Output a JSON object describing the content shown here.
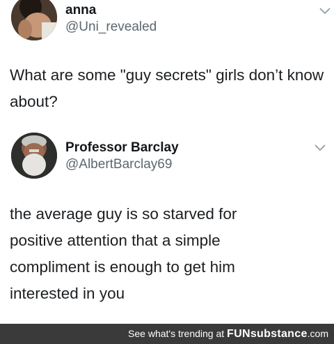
{
  "tweets": [
    {
      "name": "anna",
      "handle": "@Uni_revealed",
      "text": "What are some \"guy secrets\" girls don’t know about?"
    },
    {
      "name": "Professor Barclay",
      "handle": "@AlbertBarclay69",
      "text": "the average guy is so starved for positive attention that a simple compliment is enough to get him interested in you"
    }
  ],
  "footer": {
    "prefix": "See what's trending at ",
    "brand": "FUNsubstance",
    "suffix": ".com",
    "background": "#3a3a3a"
  },
  "icons": {
    "menu": "chevron-down-icon"
  }
}
